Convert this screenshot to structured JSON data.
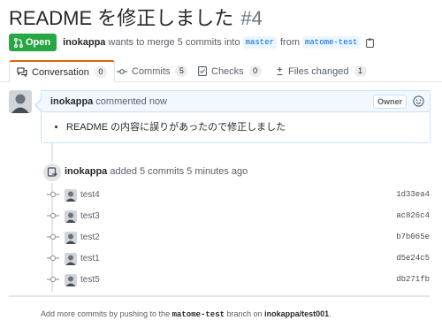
{
  "pr": {
    "title": "README を修正しました",
    "number": "#4",
    "state": "Open",
    "author": "inokappa",
    "merge_text": "wants to merge 5 commits into",
    "base_branch": "master",
    "from_text": "from",
    "head_branch": "matome-test"
  },
  "tabs": [
    {
      "label": "Conversation",
      "count": "0"
    },
    {
      "label": "Commits",
      "count": "5"
    },
    {
      "label": "Checks",
      "count": "0"
    },
    {
      "label": "Files changed",
      "count": "1"
    }
  ],
  "comment": {
    "author": "inokappa",
    "action": "commented now",
    "role": "Owner",
    "body": "README の内容に誤りがあったので修正しました"
  },
  "event": {
    "author": "inokappa",
    "text": "added 5 commits 5 minutes ago"
  },
  "commits": [
    {
      "message": "test4",
      "sha": "1d33ea4"
    },
    {
      "message": "test3",
      "sha": "ac826c4"
    },
    {
      "message": "test2",
      "sha": "b7b065e"
    },
    {
      "message": "test1",
      "sha": "d5e24c5"
    },
    {
      "message": "test5",
      "sha": "db271fb"
    }
  ],
  "footer": {
    "prefix": "Add more commits by pushing to the",
    "branch": "matome-test",
    "middle": "branch on",
    "repo": "inokappa/test001",
    "suffix": "."
  },
  "colors": {
    "open_green": "#28a745",
    "link_blue": "#0366d6",
    "tab_accent": "#e36209"
  }
}
